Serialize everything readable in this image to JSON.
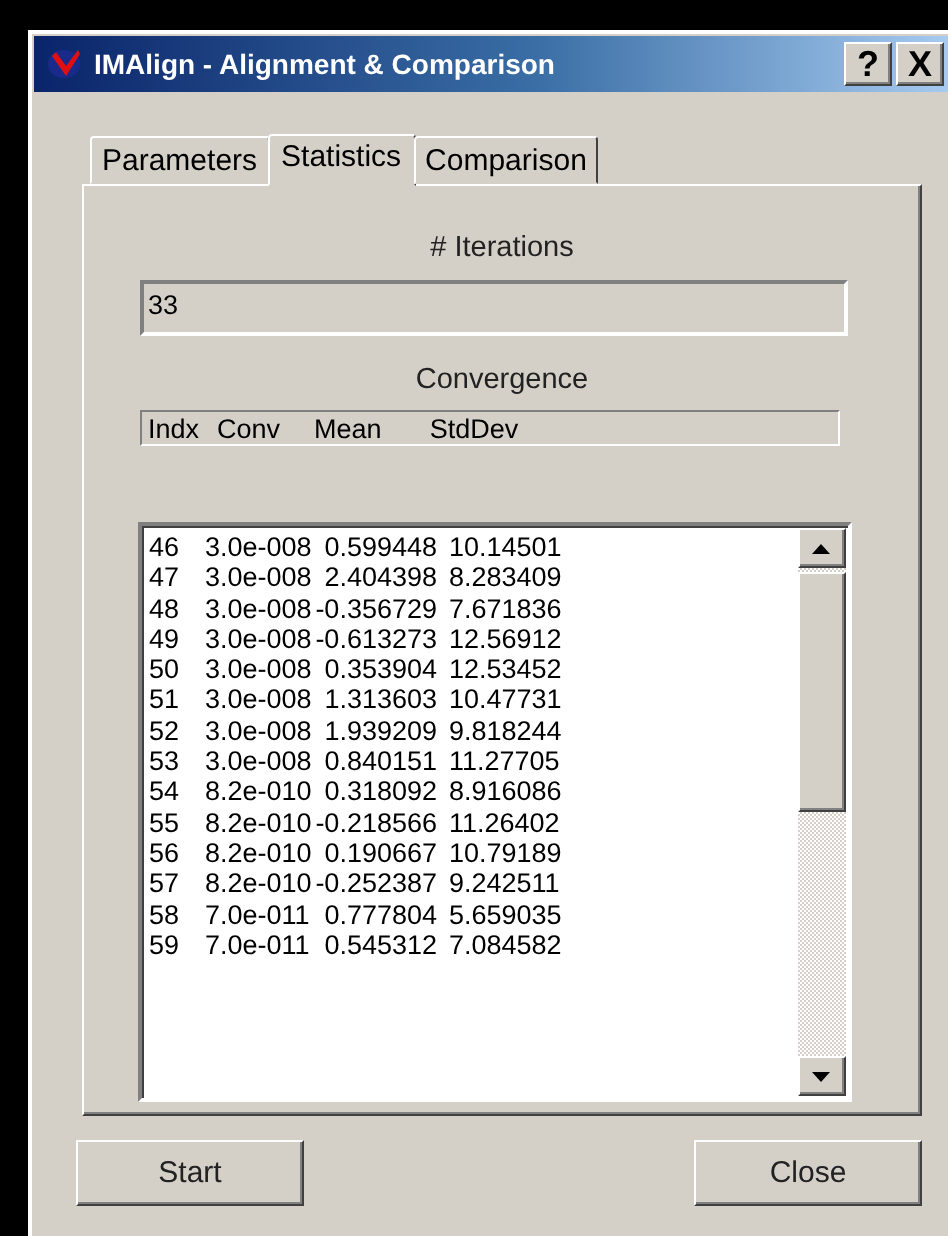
{
  "window": {
    "title": "IMAlign - Alignment & Comparison",
    "help_button": "?",
    "close_button": "X"
  },
  "tabs": [
    {
      "label": "Parameters",
      "selected": false
    },
    {
      "label": "Statistics",
      "selected": true
    },
    {
      "label": "Comparison",
      "selected": false
    }
  ],
  "iterations": {
    "label": "# Iterations",
    "value": "33"
  },
  "convergence": {
    "label": "Convergence",
    "columns": [
      "Indx",
      "Conv",
      "Mean",
      "StdDev"
    ],
    "rows": [
      {
        "indx": "46",
        "conv": "3.0e-008",
        "mean": "0.599448",
        "stddev": "10.14501"
      },
      {
        "indx": "47",
        "conv": "3.0e-008",
        "mean": "2.404398",
        "stddev": "8.283409"
      },
      {
        "indx": "48",
        "conv": "3.0e-008",
        "mean": "-0.356729",
        "stddev": "7.671836"
      },
      {
        "indx": "49",
        "conv": "3.0e-008",
        "mean": "-0.613273",
        "stddev": "12.56912"
      },
      {
        "indx": "50",
        "conv": "3.0e-008",
        "mean": "0.353904",
        "stddev": "12.53452"
      },
      {
        "indx": "51",
        "conv": "3.0e-008",
        "mean": "1.313603",
        "stddev": "10.47731"
      },
      {
        "indx": "52",
        "conv": "3.0e-008",
        "mean": "1.939209",
        "stddev": "9.818244"
      },
      {
        "indx": "53",
        "conv": "3.0e-008",
        "mean": "0.840151",
        "stddev": "11.27705"
      },
      {
        "indx": "54",
        "conv": "8.2e-010",
        "mean": "0.318092",
        "stddev": "8.916086"
      },
      {
        "indx": "55",
        "conv": "8.2e-010",
        "mean": "-0.218566",
        "stddev": "11.26402"
      },
      {
        "indx": "56",
        "conv": "8.2e-010",
        "mean": "0.190667",
        "stddev": "10.79189"
      },
      {
        "indx": "57",
        "conv": "8.2e-010",
        "mean": "-0.252387",
        "stddev": "9.242511"
      },
      {
        "indx": "58",
        "conv": "7.0e-011",
        "mean": "0.777804",
        "stddev": "5.659035"
      },
      {
        "indx": "59",
        "conv": "7.0e-011",
        "mean": "0.545312",
        "stddev": "7.084582"
      }
    ]
  },
  "buttons": [
    {
      "label": "Start"
    },
    {
      "label": "Close"
    }
  ]
}
